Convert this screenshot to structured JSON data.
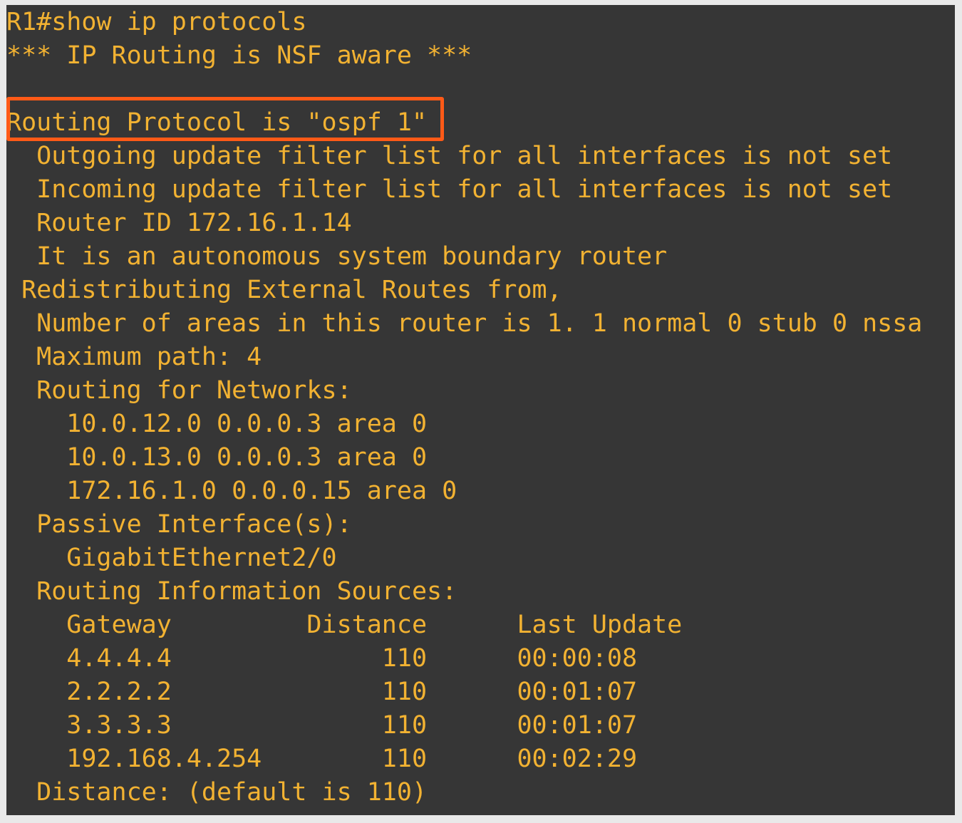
{
  "terminal": {
    "lines": [
      "R1#show ip protocols",
      "*** IP Routing is NSF aware ***",
      "",
      "Routing Protocol is \"ospf 1\"",
      "  Outgoing update filter list for all interfaces is not set",
      "  Incoming update filter list for all interfaces is not set",
      "  Router ID 172.16.1.14",
      "  It is an autonomous system boundary router",
      " Redistributing External Routes from,",
      "  Number of areas in this router is 1. 1 normal 0 stub 0 nssa",
      "  Maximum path: 4",
      "  Routing for Networks:",
      "    10.0.12.0 0.0.0.3 area 0",
      "    10.0.13.0 0.0.0.3 area 0",
      "    172.16.1.0 0.0.0.15 area 0",
      "  Passive Interface(s):",
      "    GigabitEthernet2/0",
      "  Routing Information Sources:",
      "    Gateway         Distance      Last Update",
      "    4.4.4.4              110      00:00:08",
      "    2.2.2.2              110      00:01:07",
      "    3.3.3.3              110      00:01:07",
      "    192.168.4.254        110      00:02:29",
      "  Distance: (default is 110)"
    ]
  },
  "colors": {
    "background": "#363636",
    "text": "#f2b232",
    "highlight_border": "#ff5a17",
    "page": "#e9e9e9"
  }
}
